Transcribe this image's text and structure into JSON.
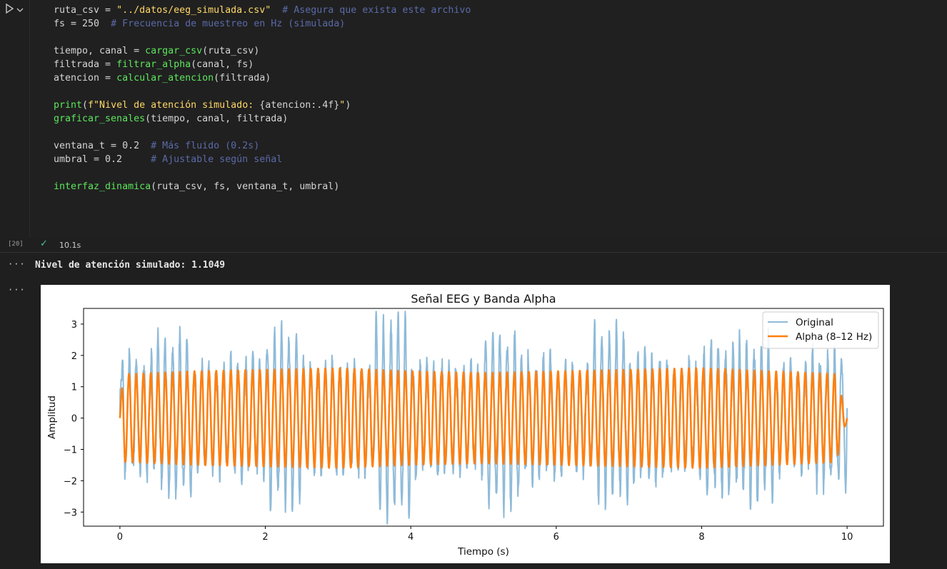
{
  "cell": {
    "execution_count": "[20]",
    "exec_time": "10.1s",
    "code_lines": [
      [
        [
          "ruta_csv = ",
          "op"
        ],
        [
          "\"../datos/eeg_simulada.csv\"",
          "str"
        ],
        [
          "  # Asegura que exista este archivo",
          "com"
        ]
      ],
      [
        [
          "fs = 250  ",
          "op"
        ],
        [
          "# Frecuencia de muestreo en Hz (simulada)",
          "com"
        ]
      ],
      [],
      [
        [
          "tiempo, canal = ",
          "op"
        ],
        [
          "cargar_csv",
          "fn"
        ],
        [
          "(ruta_csv)",
          "op"
        ]
      ],
      [
        [
          "filtrada = ",
          "op"
        ],
        [
          "filtrar_alpha",
          "fn"
        ],
        [
          "(canal, fs)",
          "op"
        ]
      ],
      [
        [
          "atencion = ",
          "op"
        ],
        [
          "calcular_atencion",
          "fn"
        ],
        [
          "(filtrada)",
          "op"
        ]
      ],
      [],
      [
        [
          "print",
          "fn"
        ],
        [
          "(",
          "op"
        ],
        [
          "f\"Nivel de atención simulado: ",
          "str"
        ],
        [
          "{atencion:.4f}",
          "op"
        ],
        [
          "\"",
          "str"
        ],
        [
          ")",
          "op"
        ]
      ],
      [
        [
          "graficar_senales",
          "fn"
        ],
        [
          "(tiempo, canal, filtrada)",
          "op"
        ]
      ],
      [],
      [
        [
          "ventana_t = 0.2  ",
          "op"
        ],
        [
          "# Más fluido (0.2s)",
          "com"
        ]
      ],
      [
        [
          "umbral = 0.2     ",
          "op"
        ],
        [
          "# Ajustable según señal",
          "com"
        ]
      ],
      [],
      [
        [
          "interfaz_dinamica",
          "fn"
        ],
        [
          "(ruta_csv, fs, ventana_t, umbral)",
          "op"
        ]
      ]
    ]
  },
  "output": {
    "dots": "···",
    "text": "Nivel de atención simulado: 1.1049"
  },
  "icons": {
    "run": "play-icon",
    "expand": "chevron-down-icon",
    "status": "check-icon"
  },
  "colors": {
    "original_series": "#8fbbd9",
    "alpha_series": "#ff7f0e"
  },
  "chart_data": {
    "type": "line",
    "title": "Señal EEG y Banda Alpha",
    "xlabel": "Tiempo (s)",
    "ylabel": "Amplitud",
    "xlim": [
      -0.5,
      10.5
    ],
    "ylim": [
      -3.45,
      3.5
    ],
    "xticks": [
      0,
      2,
      4,
      6,
      8,
      10
    ],
    "yticks": [
      -3,
      -2,
      -1,
      0,
      1,
      2,
      3
    ],
    "legend_position": "top-right",
    "x_range": [
      0,
      10
    ],
    "series": [
      {
        "name": "Original",
        "color": "#8fbbd9",
        "alpha_freq_hz": 10,
        "peak_values": [
          2.9,
          2.6,
          2.8,
          3.0,
          2.7,
          2.9,
          2.8,
          3.25,
          2.8,
          2.9,
          2.7,
          2.8,
          2.9,
          3.0,
          2.6,
          2.8,
          2.7,
          2.9,
          2.6,
          2.5
        ],
        "trough_values": [
          -2.1,
          -2.4,
          -3.0,
          -2.4,
          -2.7,
          -2.6,
          -2.6,
          -3.0,
          -2.4,
          -2.8,
          -2.8,
          -2.6,
          -2.5,
          -2.7,
          -2.5,
          -2.6,
          -2.8,
          -3.1,
          -2.7,
          -2.6
        ]
      },
      {
        "name": "Alpha (8–12 Hz)",
        "color": "#ff7f0e",
        "frequency_hz": 10,
        "amplitude": 1.55,
        "amplitude_envelope": [
          1.4,
          1.5,
          1.55,
          1.6,
          1.5,
          1.45,
          1.5,
          1.55,
          1.6,
          1.5,
          1.4
        ]
      }
    ]
  }
}
